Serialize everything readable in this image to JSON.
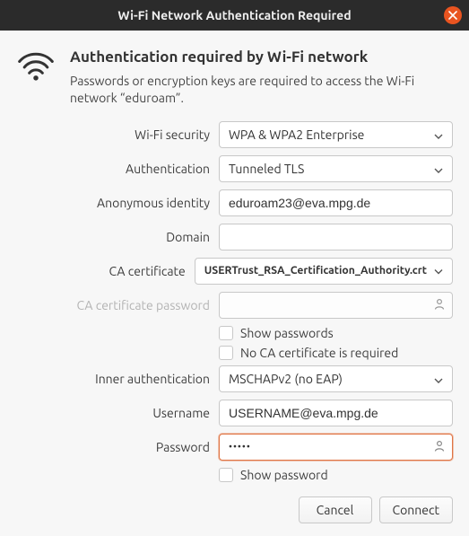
{
  "window": {
    "title": "Wi-Fi Network Authentication Required"
  },
  "header": {
    "heading": "Authentication required by Wi-Fi network",
    "subtext": "Passwords or encryption keys are required to access the Wi-Fi network “eduroam”."
  },
  "fields": {
    "wifi_security": {
      "label": "Wi-Fi security",
      "value": "WPA & WPA2 Enterprise"
    },
    "authentication": {
      "label": "Authentication",
      "value": "Tunneled TLS"
    },
    "anonymous_identity": {
      "label": "Anonymous identity",
      "value": "eduroam23@eva.mpg.de"
    },
    "domain": {
      "label": "Domain",
      "value": ""
    },
    "ca_certificate": {
      "label": "CA certificate",
      "value": "USERTrust_RSA_Certification_Authority.crt"
    },
    "ca_cert_password": {
      "label": "CA certificate password",
      "value": ""
    },
    "show_passwords": {
      "label": "Show passwords",
      "checked": false
    },
    "no_ca_required": {
      "label": "No CA certificate is required",
      "checked": false
    },
    "inner_authentication": {
      "label": "Inner authentication",
      "value": "MSCHAPv2 (no EAP)"
    },
    "username": {
      "label": "Username",
      "value": "USERNAME@eva.mpg.de"
    },
    "password": {
      "label": "Password",
      "value": "•••••"
    },
    "show_password": {
      "label": "Show password",
      "checked": false
    }
  },
  "actions": {
    "cancel": "Cancel",
    "connect": "Connect"
  }
}
